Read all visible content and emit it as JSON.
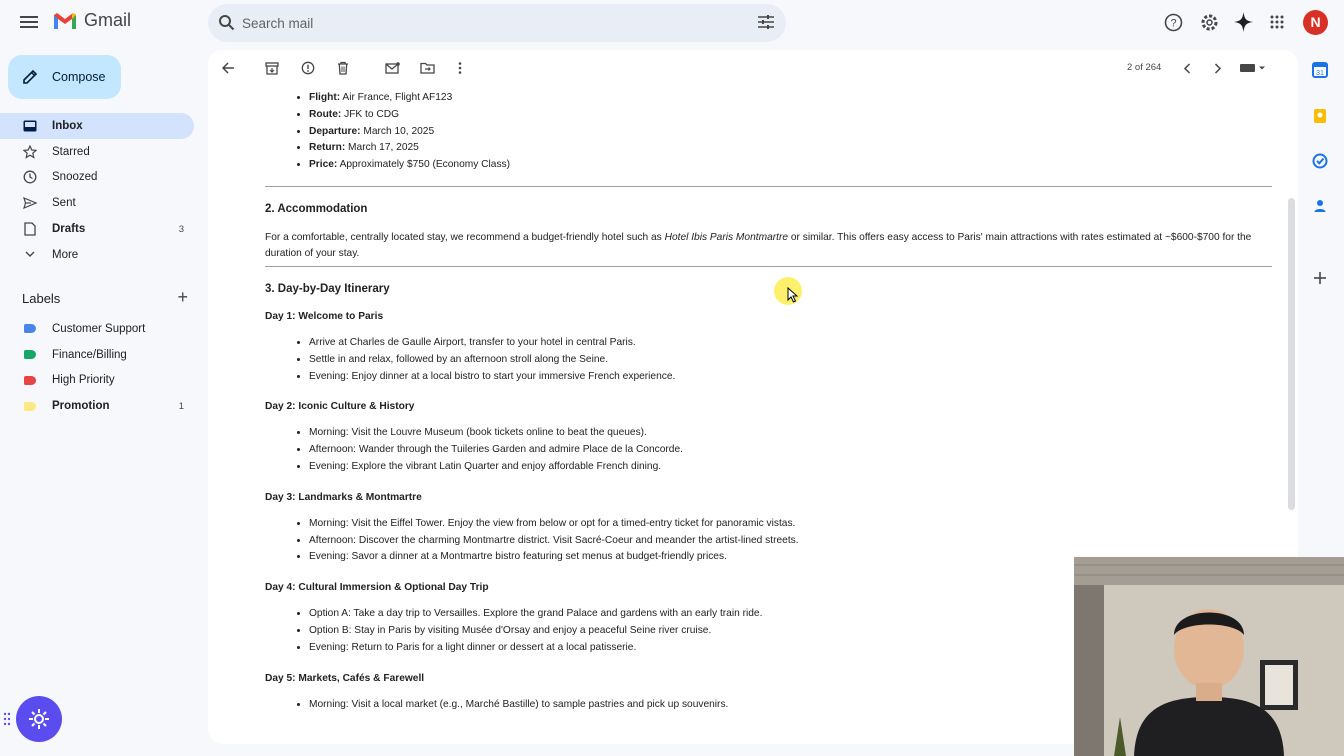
{
  "app": {
    "name": "Gmail"
  },
  "search": {
    "placeholder": "Search mail"
  },
  "account": {
    "initial": "N",
    "avatar_color": "#d93025"
  },
  "compose": {
    "label": "Compose"
  },
  "nav": [
    {
      "label": "Inbox",
      "count": "",
      "icon": "inbox-icon"
    },
    {
      "label": "Starred",
      "count": "",
      "icon": "star-icon"
    },
    {
      "label": "Snoozed",
      "count": "",
      "icon": "clock-icon"
    },
    {
      "label": "Sent",
      "count": "",
      "icon": "send-icon"
    },
    {
      "label": "Drafts",
      "count": "3",
      "icon": "draft-icon"
    },
    {
      "label": "More",
      "count": "",
      "icon": "chevron-down-icon"
    }
  ],
  "labels": {
    "title": "Labels",
    "items": [
      {
        "label": "Customer Support",
        "count": "",
        "color": "#4a86e8"
      },
      {
        "label": "Finance/Billing",
        "count": "",
        "color": "#16a765"
      },
      {
        "label": "High Priority",
        "count": "",
        "color": "#e64545"
      },
      {
        "label": "Promotion",
        "count": "1",
        "color": "#fbe983"
      }
    ]
  },
  "pager": {
    "text": "2 of 264"
  },
  "email": {
    "flight": [
      {
        "key": "Flight:",
        "value": " Air France, Flight AF123"
      },
      {
        "key": "Route:",
        "value": " JFK to CDG"
      },
      {
        "key": "Departure:",
        "value": " March 10, 2025"
      },
      {
        "key": "Return:",
        "value": " March 17, 2025"
      },
      {
        "key": "Price:",
        "value": " Approximately $750 (Economy Class)"
      }
    ],
    "accommodation": {
      "heading": "2. Accommodation",
      "text_before": "For a comfortable, centrally located stay, we recommend a budget-friendly hotel such as ",
      "hotel": "Hotel Ibis Paris Montmartre",
      "text_after": " or similar. This offers easy access to Paris' main attractions with rates estimated at ~$600-$700 for the duration of your stay."
    },
    "itinerary_heading": "3. Day-by-Day Itinerary",
    "days": [
      {
        "title": "Day 1: Welcome to Paris",
        "items": [
          "Arrive at Charles de Gaulle Airport, transfer to your hotel in central Paris.",
          "Settle in and relax, followed by an afternoon stroll along the Seine.",
          "Evening: Enjoy dinner at a local bistro to start your immersive French experience."
        ]
      },
      {
        "title": "Day 2: Iconic Culture & History",
        "items": [
          "Morning: Visit the Louvre Museum (book tickets online to beat the queues).",
          "Afternoon: Wander through the Tuileries Garden and admire Place de la Concorde.",
          "Evening: Explore the vibrant Latin Quarter and enjoy affordable French dining."
        ]
      },
      {
        "title": "Day 3: Landmarks & Montmartre",
        "items": [
          "Morning: Visit the Eiffel Tower. Enjoy the view from below or opt for a timed-entry ticket for panoramic vistas.",
          "Afternoon: Discover the charming Montmartre district. Visit Sacré-Coeur and meander the artist-lined streets.",
          "Evening: Savor a dinner at a Montmartre bistro featuring set menus at budget-friendly prices."
        ]
      },
      {
        "title": "Day 4: Cultural Immersion & Optional Day Trip",
        "items": [
          "Option A: Take a day trip to Versailles. Explore the grand Palace and gardens with an early train ride.",
          "Option B: Stay in Paris by visiting Musée d'Orsay and enjoy a peaceful Seine river cruise.",
          "Evening: Return to Paris for a light dinner or dessert at a local patisserie."
        ]
      },
      {
        "title": "Day 5: Markets, Cafés & Farewell",
        "items": [
          "Morning: Visit a local market (e.g., Marché Bastille) to sample pastries and pick up souvenirs."
        ]
      }
    ]
  }
}
